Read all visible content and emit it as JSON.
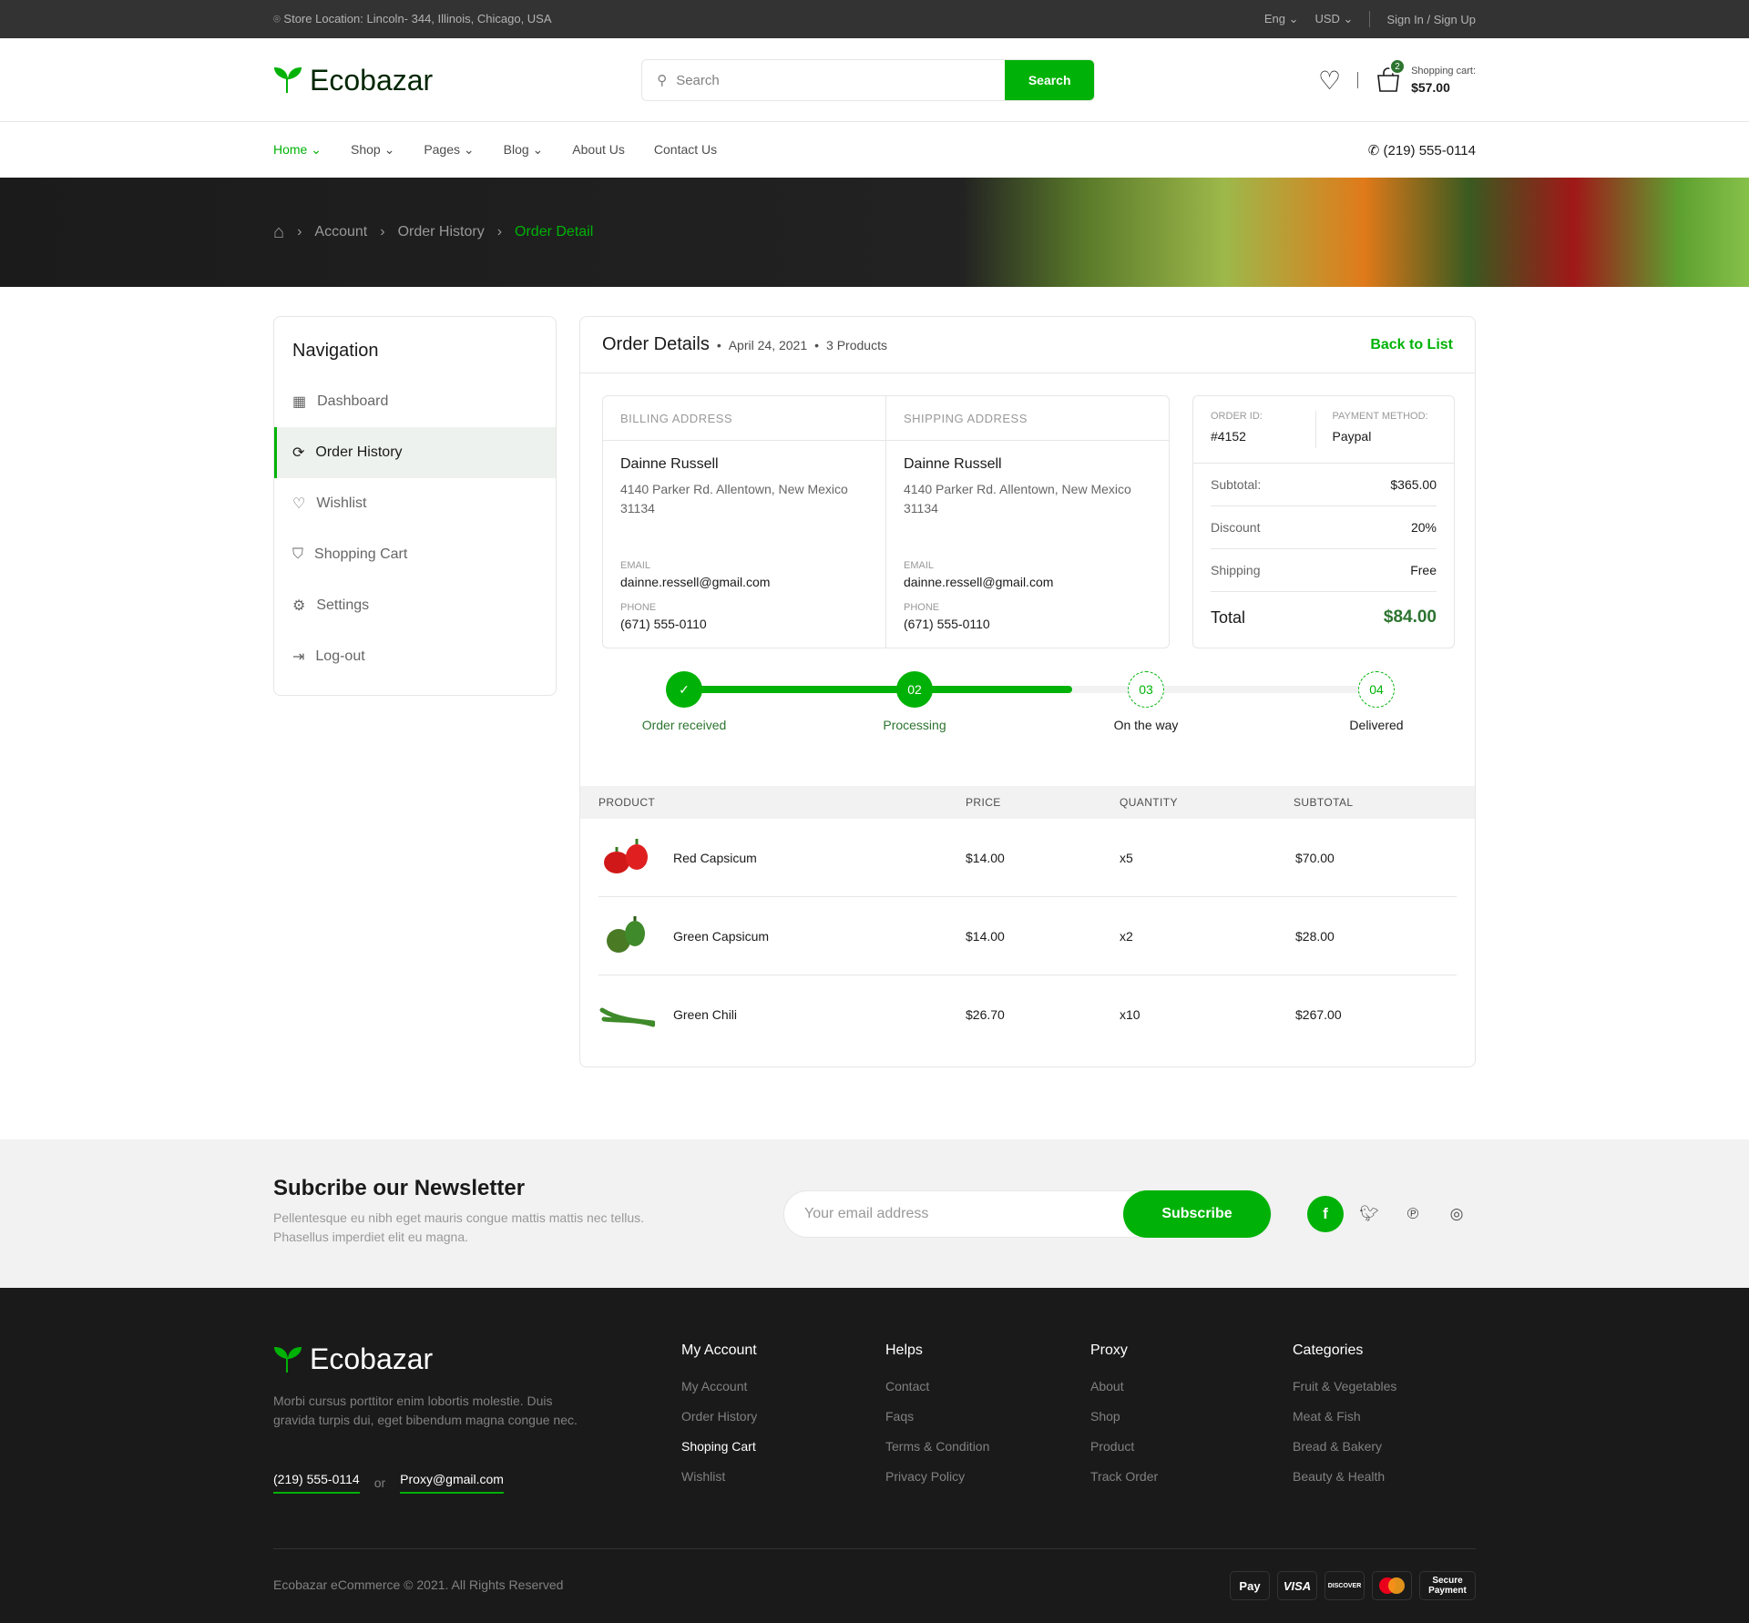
{
  "topbar": {
    "location": "Store Location: Lincoln- 344, Illinois, Chicago, USA",
    "language": "Eng",
    "currency": "USD",
    "auth": "Sign In / Sign Up"
  },
  "header": {
    "brand": "Ecobazar",
    "search_placeholder": "Search",
    "search_button": "Search",
    "cart_count": "2",
    "cart_label": "Shopping cart:",
    "cart_total": "$57.00"
  },
  "nav": {
    "items": [
      "Home",
      "Shop",
      "Pages",
      "Blog",
      "About Us",
      "Contact Us"
    ],
    "phone": "(219) 555-0114"
  },
  "breadcrumb": [
    "Account",
    "Order History",
    "Order Detail"
  ],
  "sidebar": {
    "title": "Navigation",
    "items": [
      "Dashboard",
      "Order History",
      "Wishlist",
      "Shopping Cart",
      "Settings",
      "Log-out"
    ],
    "active": "Order History"
  },
  "order": {
    "title": "Order Details",
    "date": "April 24, 2021",
    "products": "3 Products",
    "back": "Back to List",
    "billing": {
      "heading": "BILLING ADDRESS",
      "name": "Dainne Russell",
      "address": "4140 Parker Rd. Allentown, New Mexico 31134",
      "email_label": "EMAIL",
      "email": "dainne.ressell@gmail.com",
      "phone_label": "PHONE",
      "phone": "(671) 555-0110"
    },
    "shipping": {
      "heading": "SHIPPING ADDRESS",
      "name": "Dainne Russell",
      "address": "4140 Parker Rd. Allentown, New Mexico 31134",
      "email_label": "EMAIL",
      "email": "dainne.ressell@gmail.com",
      "phone_label": "PHONE",
      "phone": "(671) 555-0110"
    },
    "summary": {
      "id_label": "ORDER ID:",
      "id": "#4152",
      "method_label": "PAYMENT METHOD:",
      "method": "Paypal",
      "subtotal_label": "Subtotal:",
      "subtotal": "$365.00",
      "discount_label": "Discount",
      "discount": "20%",
      "shipping_label": "Shipping",
      "shipping": "Free",
      "total_label": "Total",
      "total": "$84.00"
    },
    "progress": {
      "percent": 56,
      "steps": [
        {
          "num": "",
          "label": "Order received",
          "done": true
        },
        {
          "num": "02",
          "label": "Processing",
          "done": true
        },
        {
          "num": "03",
          "label": "On the way",
          "done": false
        },
        {
          "num": "04",
          "label": "Delivered",
          "done": false
        }
      ]
    },
    "table": {
      "headers": [
        "PRODUCT",
        "PRICE",
        "QUANTITY",
        "SUBTOTAL"
      ],
      "rows": [
        {
          "name": "Red Capsicum",
          "price": "$14.00",
          "qty": "x5",
          "subtotal": "$70.00"
        },
        {
          "name": "Green Capsicum",
          "price": "$14.00",
          "qty": "x2",
          "subtotal": "$28.00"
        },
        {
          "name": "Green Chili",
          "price": "$26.70",
          "qty": "x10",
          "subtotal": "$267.00"
        }
      ]
    }
  },
  "newsletter": {
    "title": "Subcribe our Newsletter",
    "text": "Pellentesque eu nibh eget mauris congue mattis mattis nec tellus. Phasellus imperdiet elit eu magna.",
    "placeholder": "Your email address",
    "button": "Subscribe"
  },
  "footer": {
    "brand": "Ecobazar",
    "about": "Morbi cursus porttitor enim lobortis molestie. Duis gravida turpis dui, eget bibendum magna congue nec.",
    "phone": "(219) 555-0114",
    "or": "or",
    "email": "Proxy@gmail.com",
    "columns": [
      {
        "title": "My Account",
        "links": [
          "My Account",
          "Order History",
          "Shoping Cart",
          "Wishlist"
        ]
      },
      {
        "title": "Helps",
        "links": [
          "Contact",
          "Faqs",
          "Terms & Condition",
          "Privacy Policy"
        ]
      },
      {
        "title": "Proxy",
        "links": [
          "About",
          "Shop",
          "Product",
          "Track Order"
        ]
      },
      {
        "title": "Categories",
        "links": [
          "Fruit & Vegetables",
          "Meat & Fish",
          "Bread & Bakery",
          "Beauty & Health"
        ]
      }
    ],
    "copyright": "Ecobazar eCommerce © 2021. All Rights Reserved",
    "payments": [
      "Pay",
      "VISA",
      "DISCOVER",
      "",
      "Secure Payment"
    ]
  },
  "colors": {
    "accent": "#00b207",
    "dark_green": "#2c742f"
  }
}
